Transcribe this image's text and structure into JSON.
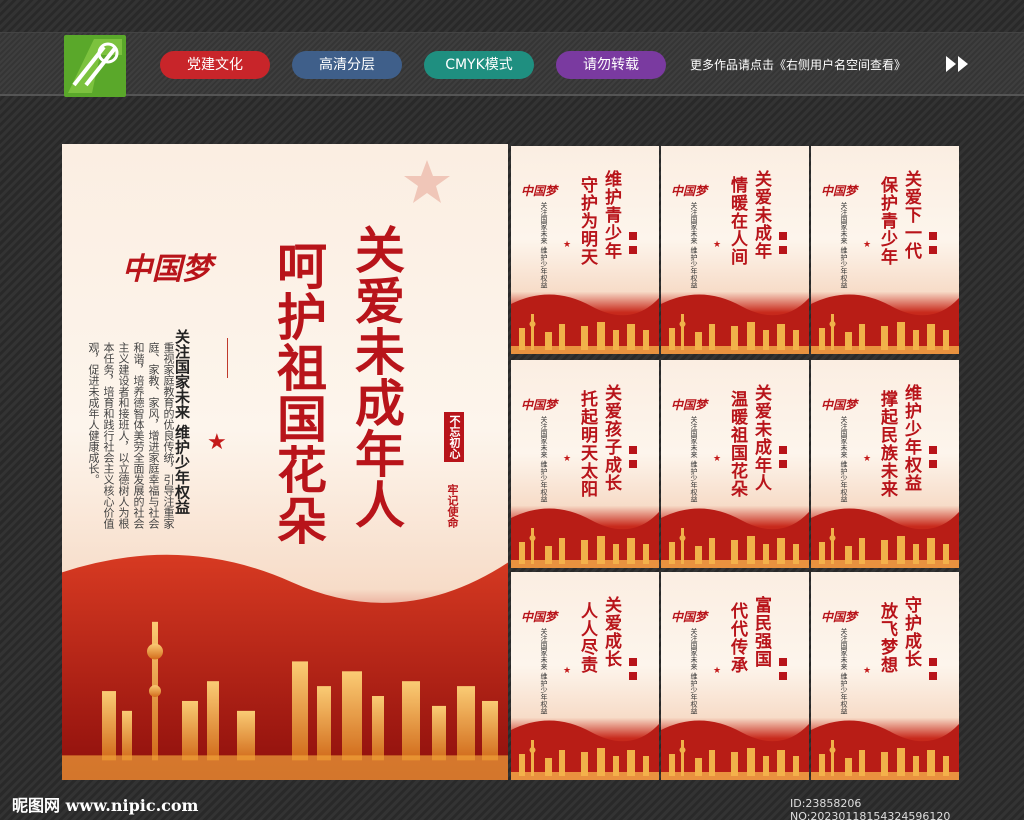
{
  "header": {
    "tags": [
      {
        "label": "党建文化",
        "color": "#c8252a"
      },
      {
        "label": "高清分层",
        "color": "#3f5f8a"
      },
      {
        "label": "CMYK模式",
        "color": "#1f8f80"
      },
      {
        "label": "请勿转载",
        "color": "#7a3aa0"
      }
    ],
    "more_text": "更多作品请点击《右侧用户名空间查看》"
  },
  "main_poster": {
    "title_line1": "关爱未成年人",
    "title_line2": "呵护祖国花朵",
    "seal": "中国梦",
    "slogan": "关注国家未来  维护少年权益",
    "body": "重视家庭教育的优良传统，引导注重家庭、家教、家风，增进家庭幸福与社会和谐，培养德智体美劳全面发展的社会主义建设者和接班人，以立德树人为根本任务，培育和践行社会主义核心价值观，促进未成年人健康成长。",
    "badge_top": "不忘初心",
    "badge_bottom": "牢记使命"
  },
  "small_posters": [
    {
      "line1": "维护青少年",
      "line2": "守护为明天"
    },
    {
      "line1": "关爱未成年",
      "line2": "情暖在人间"
    },
    {
      "line1": "关爱下一代",
      "line2": "保护青少年"
    },
    {
      "line1": "关爱孩子成长",
      "line2": "托起明天太阳"
    },
    {
      "line1": "关爱未成年人",
      "line2": "温暖祖国花朵"
    },
    {
      "line1": "维护少年权益",
      "line2": "撑起民族未来"
    },
    {
      "line1": "关爱成长",
      "line2": "人人尽责"
    },
    {
      "line1": "富民强国",
      "line2": "代代传承"
    },
    {
      "line1": "守护成长",
      "line2": "放飞梦想"
    }
  ],
  "small_slogan": "关注国家未来  维护少年权益",
  "footer": {
    "site": "昵图网 www.nipic.com",
    "id_text": "ID:23858206 NO:20230118154324596120"
  }
}
